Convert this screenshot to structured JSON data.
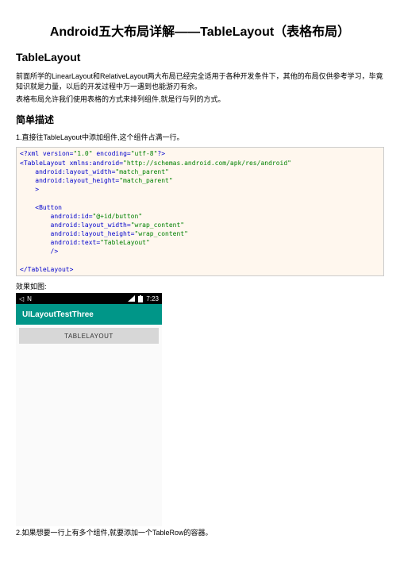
{
  "title": "Android五大布局详解——TableLayout（表格布局）",
  "h2": "TableLayout",
  "intro1": "前面所学的LinearLayout和RelativeLayout两大布局已经完全适用于各种开发条件下，其他的布局仅供参考学习，毕竟知识就是力量，以后的开发过程中万一遇到也能游刃有余。",
  "intro2": "表格布局允许我们使用表格的方式来排列组件,就是行与列的方式。",
  "h3": "简单描述",
  "point1": "1.直接往TableLayout中添加组件,这个组件占满一行。",
  "code": {
    "l1a": "<?xml version=",
    "l1b": "\"1.0\"",
    "l1c": " encoding=",
    "l1d": "\"utf-8\"",
    "l1e": "?>",
    "l2a": "<TableLayout xmlns:android=",
    "l2b": "\"http://schemas.android.com/apk/res/android\"",
    "l3a": "    android:layout_width=",
    "l3b": "\"match_parent\"",
    "l4a": "    android:layout_height=",
    "l4b": "\"match_parent\"",
    "l5": "    >",
    "l6": "",
    "l7": "    <Button",
    "l8a": "        android:id=",
    "l8b": "\"@+id/button\"",
    "l9a": "        android:layout_width=",
    "l9b": "\"wrap_content\"",
    "l10a": "        android:layout_height=",
    "l10b": "\"wrap_content\"",
    "l11a": "        android:text=",
    "l11b": "\"TableLayout\"",
    "l12": "        />",
    "l13": "",
    "l14": "</TableLayout>"
  },
  "resultLabel": "效果如图:",
  "emulator": {
    "statusLeft": "N",
    "time": "7:23",
    "appTitle": "UILayoutTestThree",
    "buttonText": "TABLELAYOUT"
  },
  "point2": "2.如果想要一行上有多个组件,就要添加一个TableRow的容器。"
}
